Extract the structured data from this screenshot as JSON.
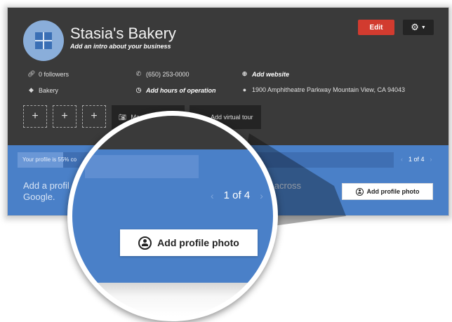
{
  "business": {
    "name": "Stasia's Bakery",
    "intro_prompt": "Add an intro about your business"
  },
  "header": {
    "edit_label": "Edit",
    "settings_icon": "gear-icon"
  },
  "info": {
    "followers": "0 followers",
    "phone": "(650) 253-0000",
    "website": "Add website",
    "category": "Bakery",
    "hours": "Add hours of operation",
    "address": "1900 Amphitheatre Parkway Mountain View, CA 94043"
  },
  "photos": {
    "slot_glyph": "+",
    "manage_label": "Ma",
    "virtual_tour_label": "Add virtual tour"
  },
  "completion": {
    "progress_text": "Your profile is 55% co",
    "progress_percent": 55,
    "pager": "1 of 4",
    "prompt_line1": "Add a profil",
    "prompt_line1_end": "across",
    "prompt_line2": "Google.",
    "add_photo_label": "Add profile photo"
  },
  "magnifier": {
    "pager": "1 of 4",
    "add_photo_label": "Add profile photo"
  },
  "colors": {
    "panel_dark": "#3a3a3a",
    "accent_blue": "#4a80c8",
    "edit_red": "#d23b2f"
  }
}
